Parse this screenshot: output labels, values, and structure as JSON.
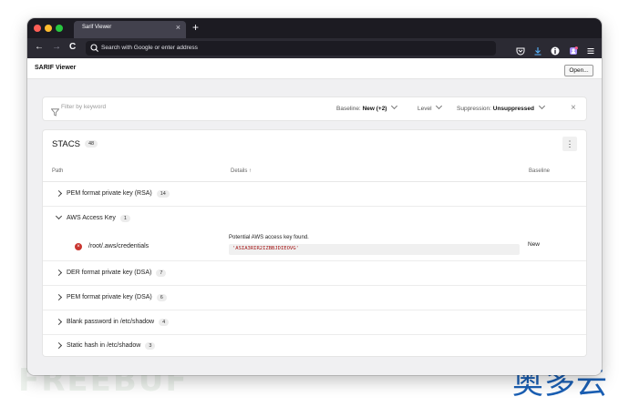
{
  "browser": {
    "tab_title": "Sarif Viewer",
    "tab_close": "×",
    "new_tab": "+",
    "back": "←",
    "forward": "→",
    "reload": "C",
    "url_placeholder": "Search with Google or enter address"
  },
  "app": {
    "title": "SARIF Viewer",
    "open_label": "Open..."
  },
  "filter": {
    "placeholder": "Filter by keyword",
    "baseline_label": "Baseline:",
    "baseline_value": "New (+2)",
    "level_label": "Level",
    "suppression_label": "Suppression:",
    "suppression_value": "Unsuppressed",
    "clear": "×"
  },
  "card": {
    "title": "STACS",
    "count": "48",
    "more": "⋮",
    "columns": {
      "path": "Path",
      "details": "Details ↑",
      "baseline": "Baseline"
    },
    "groups": [
      {
        "label": "PEM format private key (RSA)",
        "count": "14",
        "expanded": false
      },
      {
        "label": "AWS Access Key",
        "count": "1",
        "expanded": true
      },
      {
        "label": "DER format private key (DSA)",
        "count": "7",
        "expanded": false
      },
      {
        "label": "PEM format private key (DSA)",
        "count": "6",
        "expanded": false
      },
      {
        "label": "Blank password in /etc/shadow",
        "count": "4",
        "expanded": false
      },
      {
        "label": "Static hash in /etc/shadow",
        "count": "3",
        "expanded": false
      }
    ],
    "result": {
      "path": "/root/.aws/credentials",
      "message": "Potential AWS access key found.",
      "snippet": "'ASIA3RIR2IZBBJDIEOVG'",
      "baseline": "New",
      "level_icon": "×"
    }
  },
  "watermarks": {
    "left": "FREEBUF",
    "right": "奥多云"
  },
  "colors": {
    "titlebar": "#1c1b22",
    "navbar": "#2b2a33",
    "error": "#c9352f",
    "code": "#a31515"
  }
}
